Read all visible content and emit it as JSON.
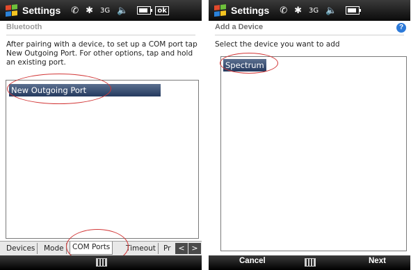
{
  "left": {
    "status": {
      "title": "Settings",
      "signal_3g": "3G",
      "ok_label": "ok"
    },
    "header_title": "Bluetooth",
    "instruction": "After pairing with a device, to set up a COM port tap New Outgoing Port. For other options, tap and hold an existing port.",
    "list": [
      {
        "label": "New Outgoing Port",
        "selected": true
      }
    ],
    "tabs": [
      {
        "label": "Devices",
        "active": false
      },
      {
        "label": "Mode",
        "active": false
      },
      {
        "label": "COM Ports",
        "active": true
      },
      {
        "label": "Timeout",
        "active": false
      },
      {
        "label": "Pr",
        "active": false
      }
    ],
    "tab_arrows": {
      "prev": "<",
      "next": ">"
    },
    "softbar": {
      "center_icon": "keyboard-icon"
    }
  },
  "right": {
    "status": {
      "title": "Settings",
      "signal_3g": "3G"
    },
    "header_title": "Add a Device",
    "help": "?",
    "instruction": "Select the device you want to add",
    "list": [
      {
        "label": "Spectrum",
        "selected": true
      }
    ],
    "softbar": {
      "left": "Cancel",
      "right": "Next",
      "center_icon": "keyboard-icon"
    }
  },
  "colors": {
    "annotation_red": "#d23636",
    "selection_blue": "#24395e"
  }
}
